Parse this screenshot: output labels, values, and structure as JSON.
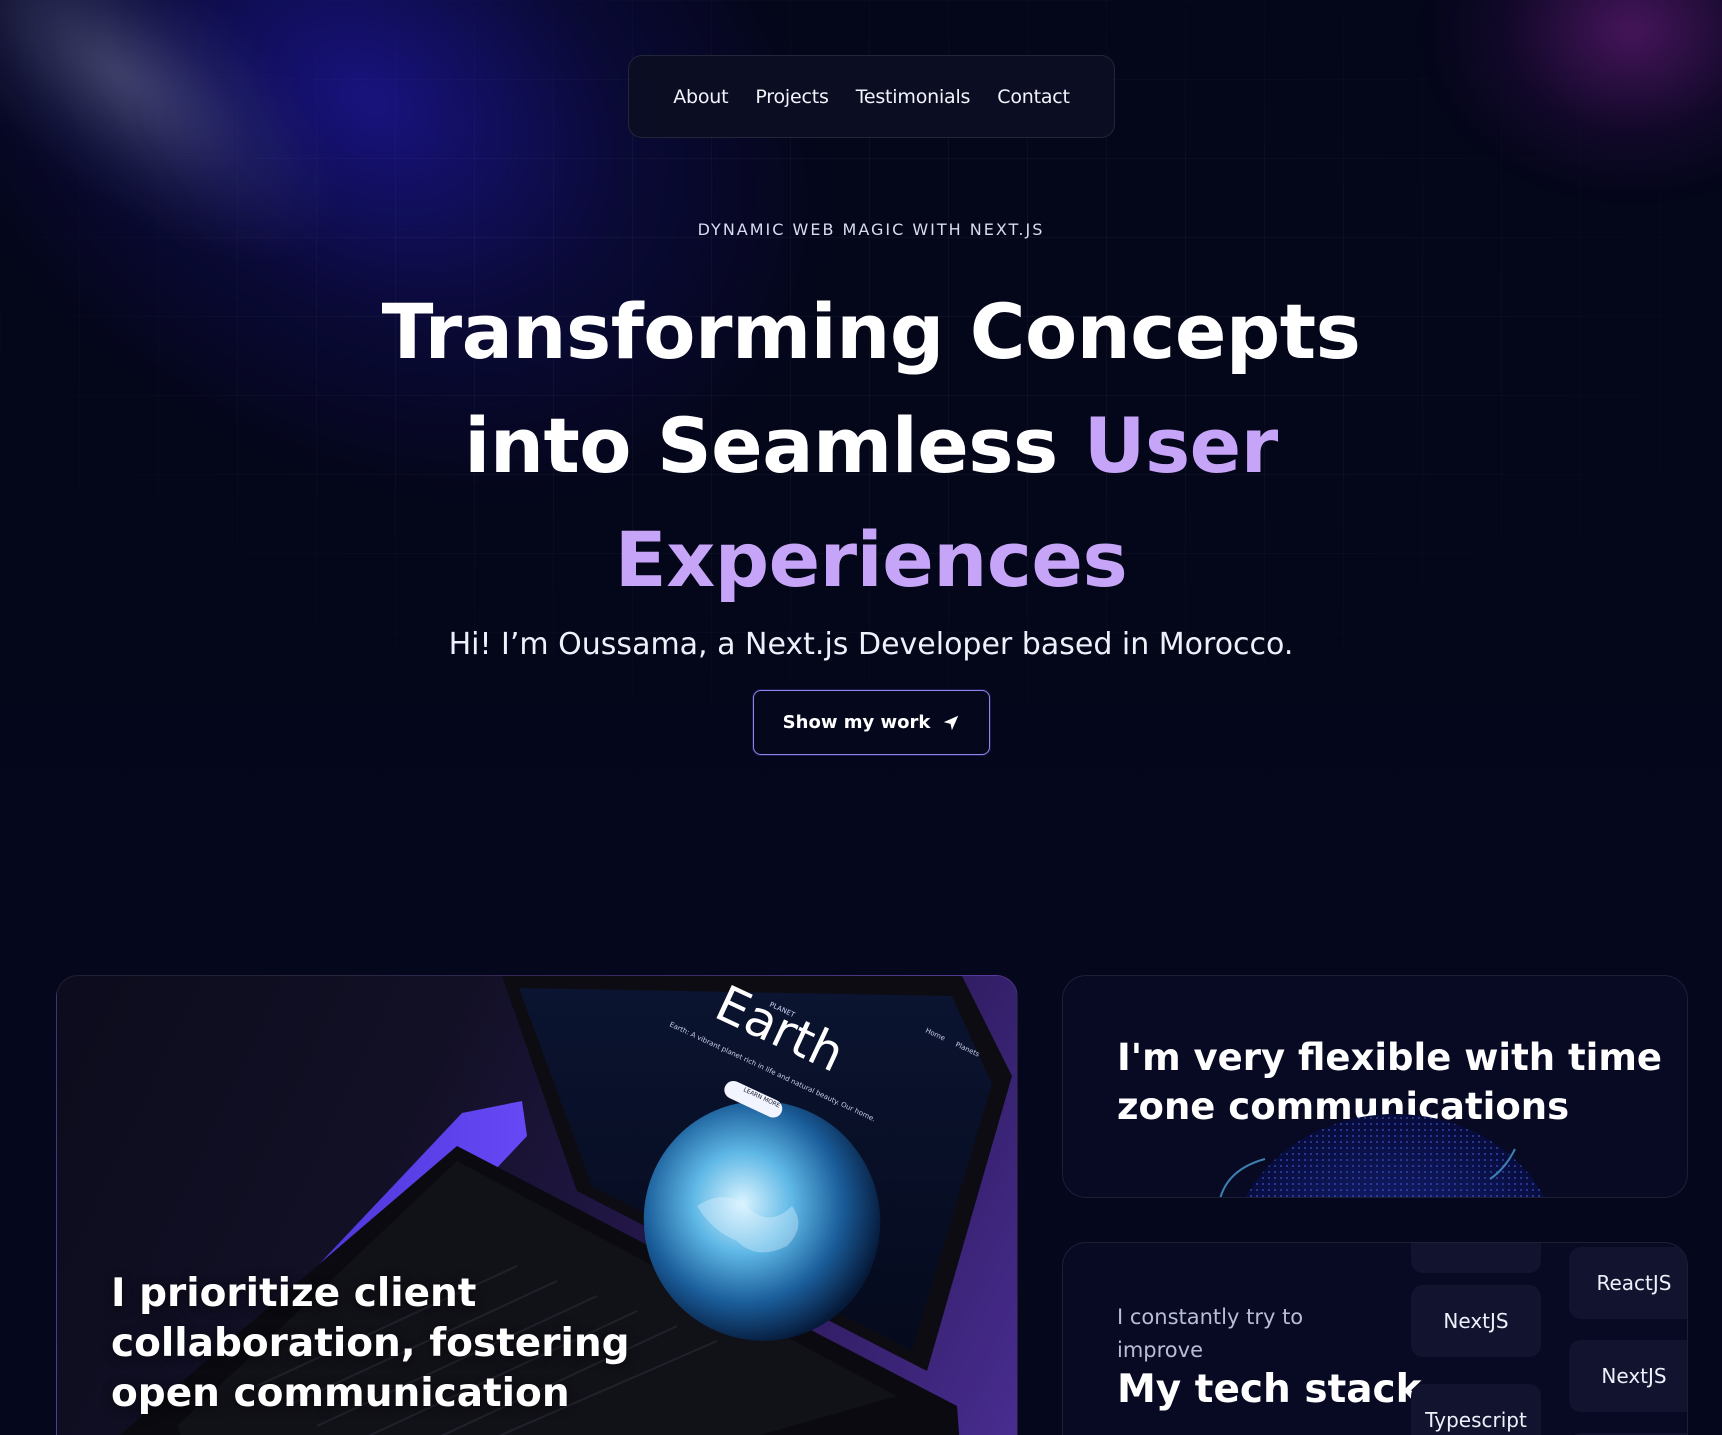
{
  "nav": {
    "items": [
      {
        "label": "About"
      },
      {
        "label": "Projects"
      },
      {
        "label": "Testimonials"
      },
      {
        "label": "Contact"
      }
    ]
  },
  "hero": {
    "eyebrow": "DYNAMIC WEB MAGIC WITH NEXT.JS",
    "headline_part1": "Transforming Concepts into Seamless ",
    "headline_accent": "User Experiences",
    "intro": "Hi! I’m Oussama, a Next.js Developer based in Morocco.",
    "cta_label": "Show my work",
    "cta_icon": "send-arrow-icon"
  },
  "cards": {
    "collaboration": {
      "title": "I prioritize client collaboration, fostering open communication",
      "laptop_screen": {
        "brand": "PLANET",
        "title": "Earth",
        "tagline": "Earth: A vibrant planet rich in life and natural beauty. Our home.",
        "button": "LEARN MORE",
        "nav": [
          "Home",
          "Planets"
        ]
      }
    },
    "timezone": {
      "title": "I'm very flexible with time zone communications"
    },
    "tech_stack": {
      "subtitle": "I constantly try to improve",
      "title": "My tech stack",
      "column_left": [
        "",
        "NextJS",
        "Typescript"
      ],
      "column_right": [
        "ReactJS",
        "NextJS",
        ""
      ]
    }
  },
  "colors": {
    "background": "#05071d",
    "accent_purple": "#c6a4f7",
    "cta_border": "#8b86e8",
    "chip_bg": "#12142f"
  }
}
